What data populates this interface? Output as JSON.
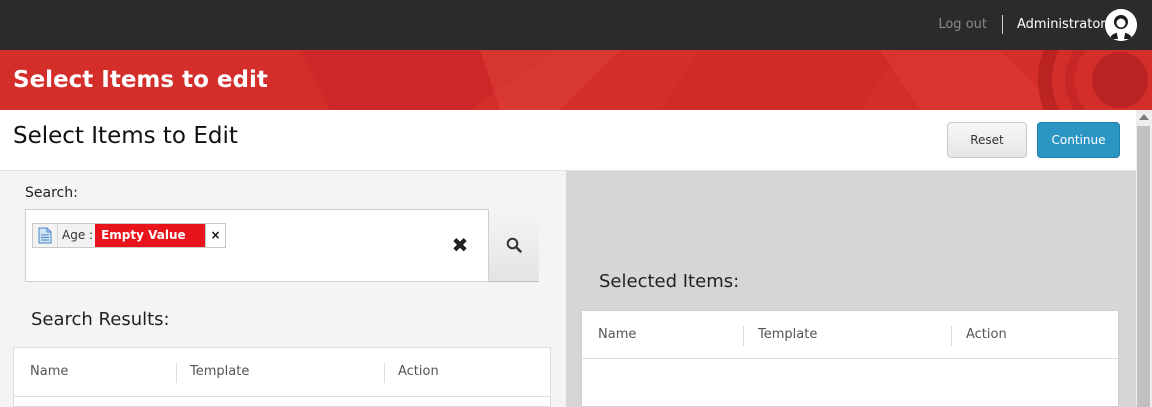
{
  "topbar": {
    "logout_label": "Log out",
    "username": "Administrator",
    "avatar_icon": "user-avatar-icon"
  },
  "header": {
    "title": "Select Items to edit",
    "accent_color": "#d42e2a"
  },
  "page": {
    "title": "Select Items to Edit",
    "reset_label": "Reset",
    "continue_label": "Continue",
    "continue_color": "#2b96c4"
  },
  "search": {
    "label": "Search:",
    "token": {
      "icon": "document-icon",
      "field": "Age :",
      "value": "Empty Value",
      "value_color": "#e8141c",
      "remove_label": "×"
    },
    "clear_icon": "clear-x-icon",
    "search_icon": "magnifier-icon"
  },
  "results": {
    "title": "Search Results:",
    "columns": [
      "Name",
      "Template",
      "Action"
    ],
    "rows": []
  },
  "selected": {
    "title": "Selected Items:",
    "columns": [
      "Name",
      "Template",
      "Action"
    ],
    "rows": []
  }
}
